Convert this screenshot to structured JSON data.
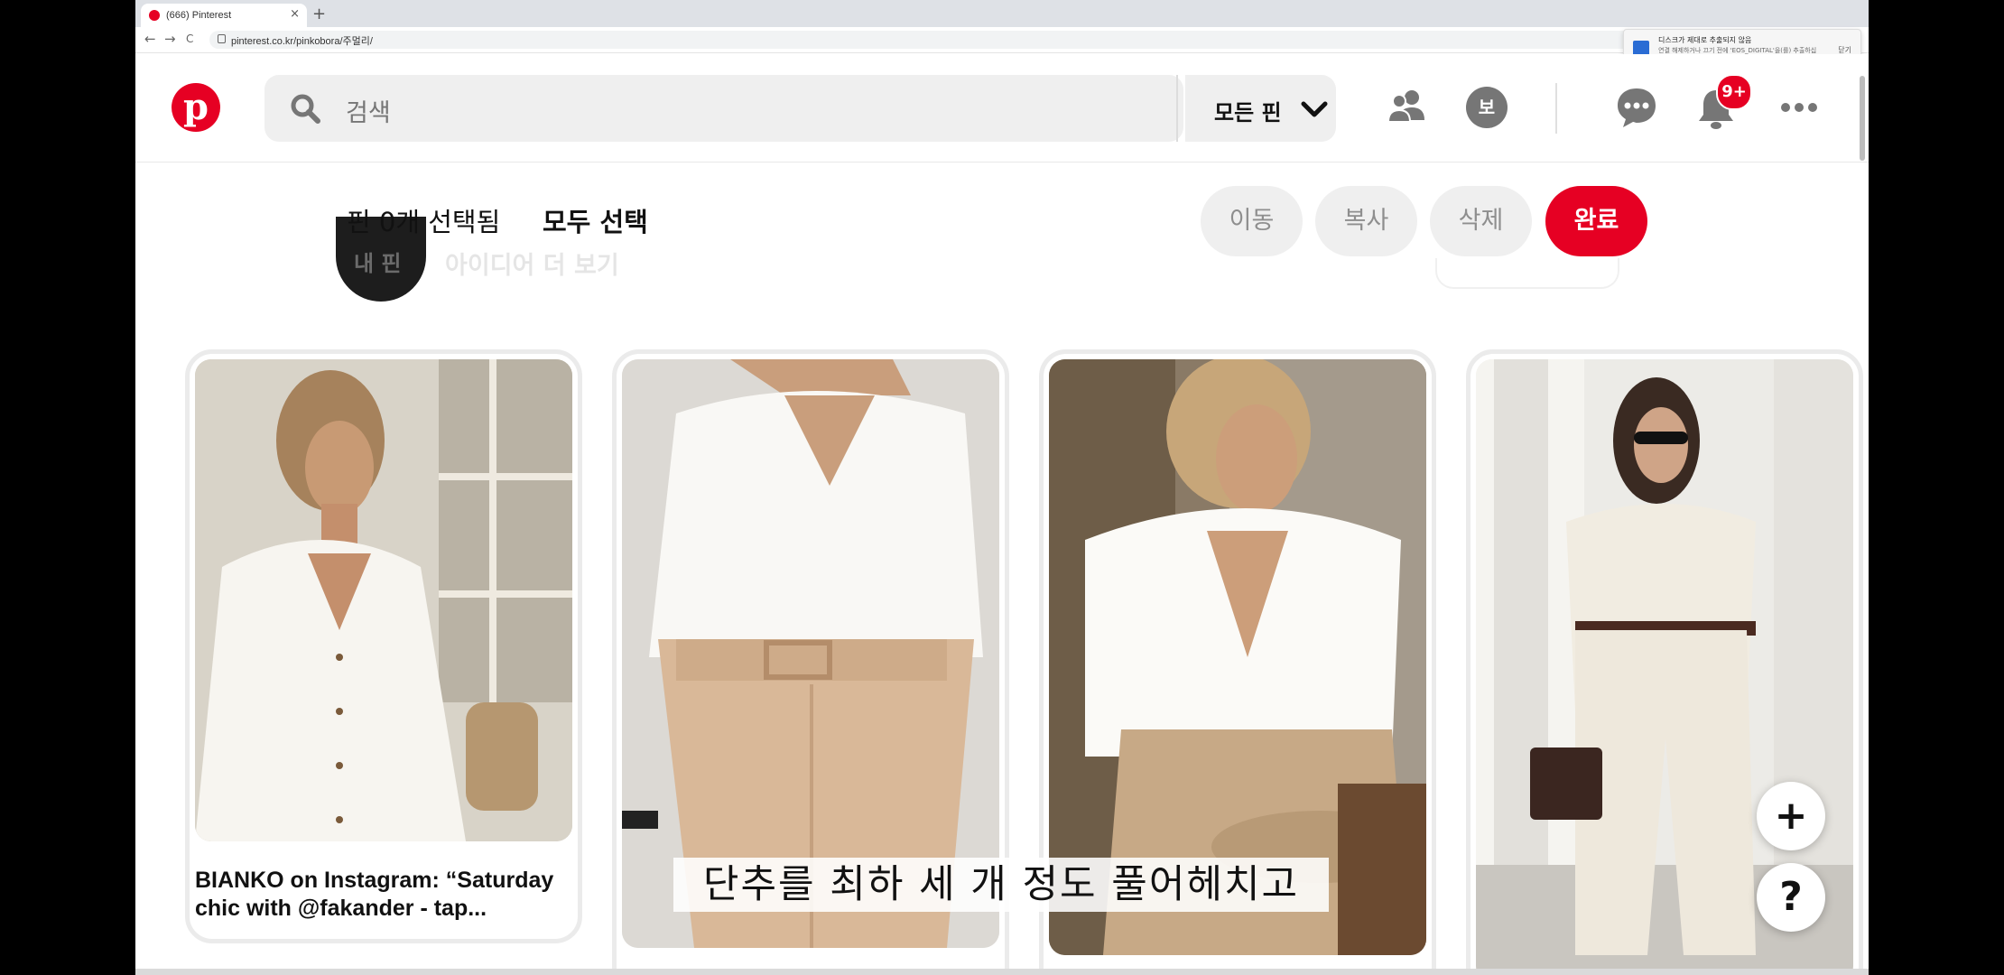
{
  "browser": {
    "tab_title": "(666) Pinterest",
    "tab_close": "×",
    "new_tab": "+",
    "back": "←",
    "forward": "→",
    "reload": "C",
    "url": "pinterest.co.kr/pinkobora/주멀리/"
  },
  "notification": {
    "title": "디스크가 제대로 추출되지 않음",
    "body": "연결 해제하거나 끄기 전에 'EOS_DIGITAL'을(를) 추출하십시오.",
    "close": "닫기"
  },
  "header": {
    "logo": "p",
    "search_placeholder": "검색",
    "filter_label": "모든 핀",
    "profile_initial": "보",
    "notification_count": "9+",
    "brand_color": "#e60023"
  },
  "selection": {
    "count_label": "핀 0개 선택됨",
    "select_all": "모두 선택",
    "move": "이동",
    "copy": "복사",
    "delete": "삭제",
    "done": "완료"
  },
  "background": {
    "my_pins": "내 핀",
    "more_ideas": "아이디어 더 보기"
  },
  "pins": [
    {
      "title": "BIANKO on Instagram: “Saturday chic with @fakander - tap..."
    },
    {
      "title": ""
    },
    {
      "title": ""
    },
    {
      "title": ""
    }
  ],
  "subtitle": "단추를 최하 세 개 정도 풀어헤치고",
  "fab": {
    "add": "+",
    "help": "?"
  }
}
